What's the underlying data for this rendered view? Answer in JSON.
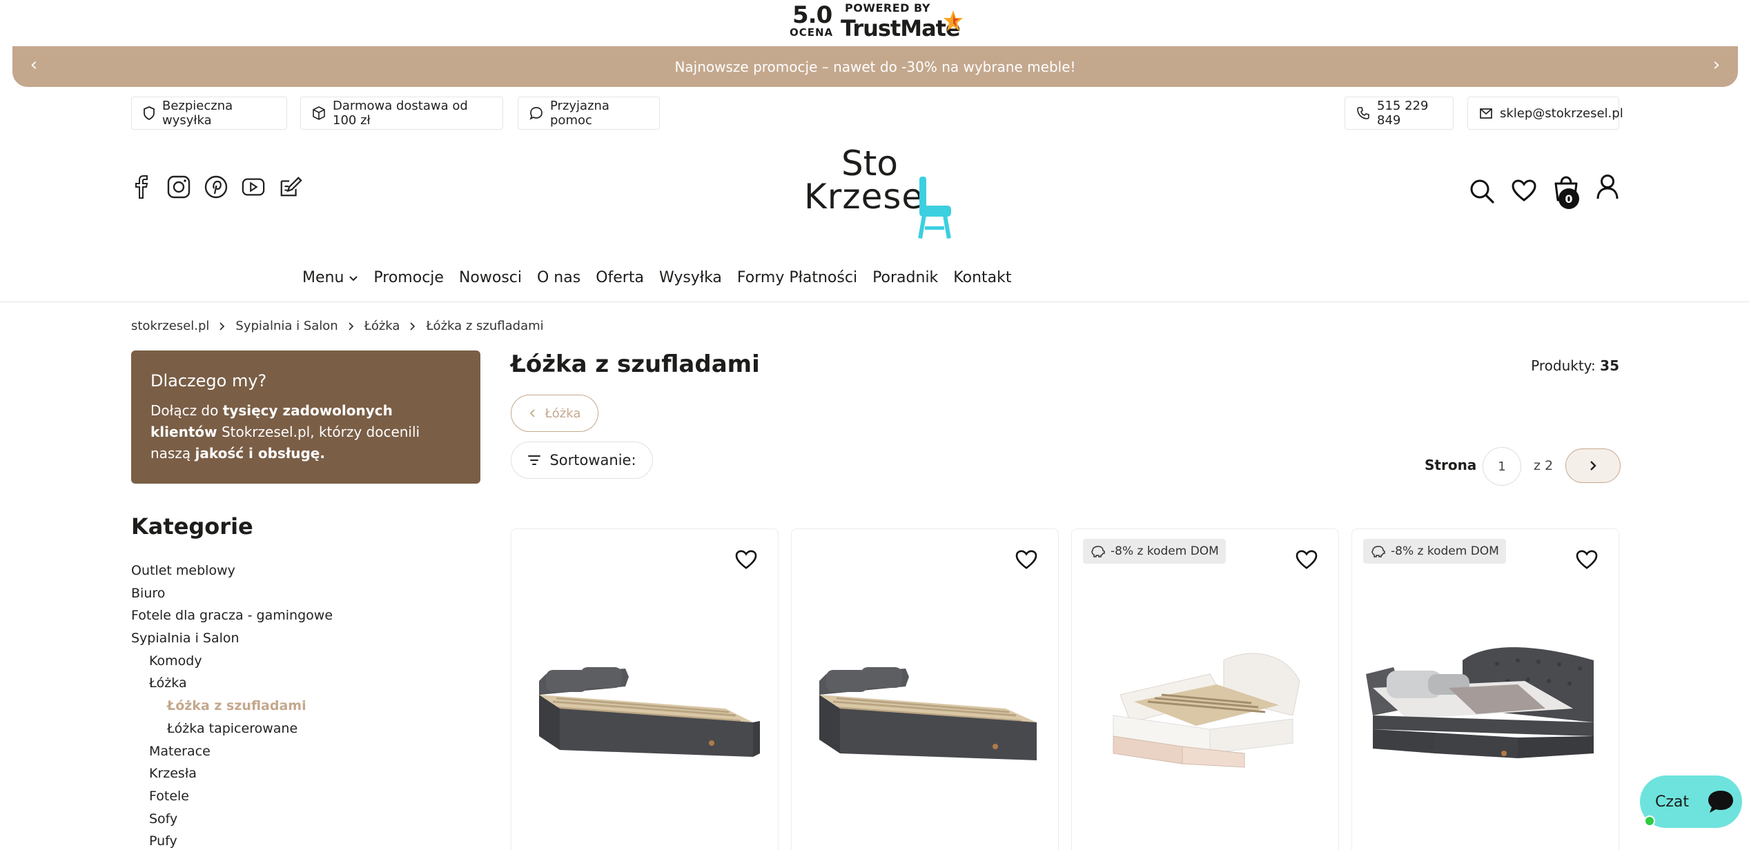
{
  "trustmate": {
    "score": "5.0",
    "score_label": "OCENA",
    "powered_by": "POWERED BY",
    "brand": "TrustMate"
  },
  "promo_bar": {
    "text": "Najnowsze promocje – nawet do -30% na wybrane meble!"
  },
  "info_pills": {
    "shipping": "Bezpieczna wysyłka",
    "free_delivery": "Darmowa dostawa od 100 zł",
    "help": "Przyjazna pomoc",
    "phone": "515 229 849",
    "email": "sklep@stokrzesel.pl"
  },
  "logo": {
    "line1": "Sto",
    "line2": "Krzese"
  },
  "cart": {
    "count": "0"
  },
  "nav": {
    "menu": "Menu",
    "items": [
      "Promocje",
      "Nowosci",
      "O nas",
      "Oferta",
      "Wysyłka",
      "Formy Płatności",
      "Poradnik",
      "Kontakt"
    ]
  },
  "breadcrumb": [
    "stokrzesel.pl",
    "Sypialnia i Salon",
    "Łóżka",
    "Łóżka z szufladami"
  ],
  "why_us": {
    "title": "Dlaczego my?",
    "text_1": "Dołącz do ",
    "bold_1": "tysięcy zadowolonych klientów",
    "text_2": " Stokrzesel.pl, którzy docenili naszą ",
    "bold_2": "jakość i obsługę."
  },
  "categories": {
    "title": "Kategorie",
    "items": [
      {
        "label": "Outlet meblowy",
        "level": 1
      },
      {
        "label": "Biuro",
        "level": 1
      },
      {
        "label": "Fotele dla gracza - gamingowe",
        "level": 1
      },
      {
        "label": "Sypialnia i Salon",
        "level": 1
      },
      {
        "label": "Komody",
        "level": 2
      },
      {
        "label": "Łóżka",
        "level": 2
      },
      {
        "label": "Łóżka z szufladami",
        "level": 3,
        "active": true
      },
      {
        "label": "Łóżka tapicerowane",
        "level": 3
      },
      {
        "label": "Materace",
        "level": 2
      },
      {
        "label": "Krzesła",
        "level": 2
      },
      {
        "label": "Fotele",
        "level": 2
      },
      {
        "label": "Sofy",
        "level": 2
      },
      {
        "label": "Pufy",
        "level": 2
      }
    ]
  },
  "listing": {
    "title": "Łóżka z szufladami",
    "products_label": "Produkty:",
    "products_count": "35",
    "back_label": "Łóżka",
    "sort_label": "Sortowanie:",
    "page_label": "Strona",
    "current_page": "1",
    "total_pages": "z 2"
  },
  "products": [
    {
      "promo": ""
    },
    {
      "promo": ""
    },
    {
      "promo": "-8% z kodem DOM"
    },
    {
      "promo": "-8% z kodem DOM"
    }
  ],
  "chat": {
    "label": "Czat"
  },
  "colors": {
    "accent": "#c4a88d",
    "why_bg": "#7a5e46",
    "chat": "#6ee3dd",
    "chair": "#3ccfe0"
  }
}
